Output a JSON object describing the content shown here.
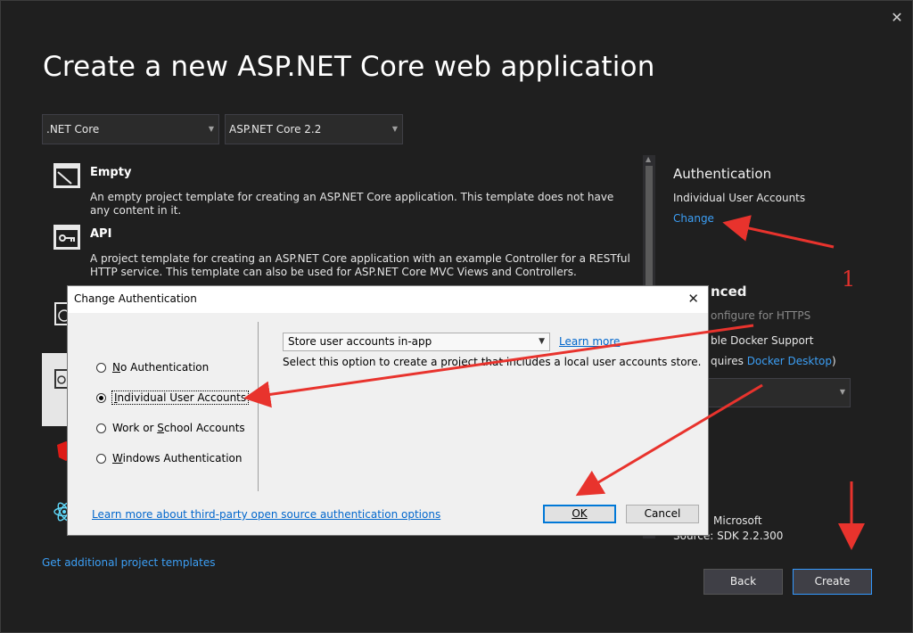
{
  "window": {
    "title": "Create a new ASP.NET Core web application",
    "close_icon": "close-icon"
  },
  "filters": {
    "framework": ".NET Core",
    "version": "ASP.NET Core 2.2"
  },
  "templates": [
    {
      "name": "Empty",
      "icon": "empty-template-icon",
      "description": "An empty project template for creating an ASP.NET Core application. This template does not have any content in it."
    },
    {
      "name": "API",
      "icon": "api-template-icon",
      "description": "A project template for creating an ASP.NET Core application with an example Controller for a RESTful HTTP service. This template can also be used for ASP.NET Core MVC Views and Controllers."
    }
  ],
  "get_more_templates": "Get additional project templates",
  "side_panel": {
    "auth_heading": "Authentication",
    "auth_value": "Individual User Accounts",
    "change_link": "Change",
    "advanced_heading": "nced",
    "https_label": "onfigure for HTTPS",
    "docker_label": "ble Docker Support",
    "requires_prefix": "quires ",
    "docker_desktop_link": "Docker Desktop",
    "requires_suffix": ")",
    "source_line1": "Microsoft",
    "source_line2": "Source: SDK 2.2.300"
  },
  "buttons": {
    "back": "Back",
    "create": "Create"
  },
  "annotation": {
    "number": "1",
    "color": "#e0312c"
  },
  "dialog": {
    "title": "Change Authentication",
    "options": [
      {
        "pre": "",
        "mn": "N",
        "post": "o Authentication",
        "selected": false
      },
      {
        "pre": "",
        "mn": "I",
        "post": "ndividual User Accounts",
        "selected": true
      },
      {
        "pre": "Work or ",
        "mn": "S",
        "post": "chool Accounts",
        "selected": false
      },
      {
        "pre": "",
        "mn": "W",
        "post": "indows Authentication",
        "selected": false
      }
    ],
    "store_select": "Store user accounts in-app",
    "learn_more": "Learn more",
    "description": "Select this option to create a project that includes a local user accounts store.",
    "third_party_link": "Learn more about third-party open source authentication options",
    "ok": "OK",
    "cancel": "Cancel"
  }
}
